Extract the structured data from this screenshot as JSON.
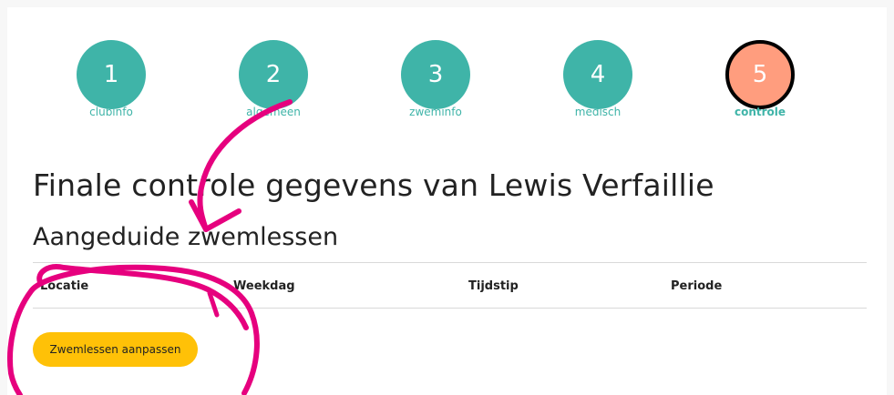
{
  "steps": [
    {
      "number": "1",
      "label": "clubinfo",
      "active": false
    },
    {
      "number": "2",
      "label": "algemeen",
      "active": false
    },
    {
      "number": "3",
      "label": "zweminfo",
      "active": false
    },
    {
      "number": "4",
      "label": "medisch",
      "active": false
    },
    {
      "number": "5",
      "label": "controle",
      "active": true
    }
  ],
  "main": {
    "title": "Finale controle gegevens van Lewis Verfaillie",
    "section_title": "Aangeduide zwemlessen",
    "table": {
      "columns": [
        "Locatie",
        "Weekdag",
        "Tijdstip",
        "Periode"
      ],
      "rows": []
    },
    "edit_button_label": "Zwemlessen aanpassen"
  },
  "colors": {
    "step_complete": "#3fb4a8",
    "step_active": "#ff9d7e",
    "button": "#ffc107",
    "annotation": "#e6007e"
  }
}
